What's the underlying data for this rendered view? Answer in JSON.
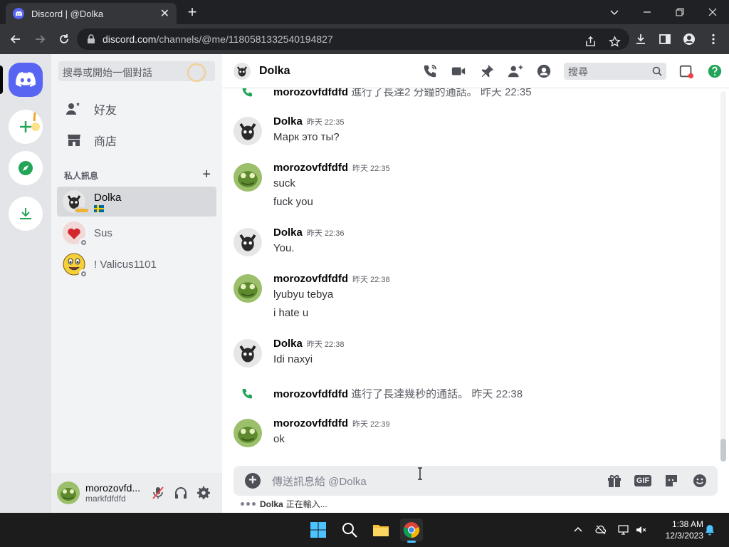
{
  "browser": {
    "tab_title": "Discord | @Dolka",
    "url_host": "discord.com",
    "url_path": "/channels/@me/1180581332540194827"
  },
  "sidebar": {
    "search_placeholder": "搜尋或開始一個對話",
    "friends_label": "好友",
    "shop_label": "商店",
    "dm_header": "私人訊息",
    "dms": [
      {
        "name": "Dolka",
        "selected": true
      },
      {
        "name": "Sus",
        "selected": false
      },
      {
        "name": "! Valicus1101",
        "selected": false
      }
    ]
  },
  "user_panel": {
    "display_name": "morozovfd...",
    "username": "markfdfdfd"
  },
  "chat": {
    "title": "Dolka",
    "search_placeholder": "搜尋",
    "composer_placeholder": "傳送訊息給 @Dolka",
    "gif_label": "GIF",
    "typing_user": "Dolka",
    "typing_text": "正在輸入...",
    "top_system": {
      "author": "morozovfdfdfd",
      "text": " 進行了長達2 分鐘的通話。",
      "time": "昨天 22:35"
    },
    "messages": [
      {
        "author": "Dolka",
        "time": "昨天 22:35",
        "lines": [
          "Марк это ты?"
        ]
      },
      {
        "author": "morozovfdfdfd",
        "time": "昨天 22:35",
        "lines": [
          "suck",
          "fuck you"
        ]
      },
      {
        "author": "Dolka",
        "time": "昨天 22:36",
        "lines": [
          "You."
        ]
      },
      {
        "author": "morozovfdfdfd",
        "time": "昨天 22:38",
        "lines": [
          "lyubyu tebya",
          "i hate u"
        ]
      },
      {
        "author": "Dolka",
        "time": "昨天 22:38",
        "lines": [
          "Idi naxyi"
        ]
      }
    ],
    "system_call": {
      "author": "morozovfdfdfd",
      "text": " 進行了長達幾秒的通話。",
      "time": "昨天 22:38"
    },
    "last_message": {
      "author": "morozovfdfdfd",
      "time": "昨天 22:39",
      "lines": [
        "ok"
      ]
    }
  },
  "taskbar": {
    "time": "1:38 AM",
    "date": "12/3/2023"
  },
  "colors": {
    "blurple": "#5865f2",
    "call_green": "#23a559",
    "help_green": "#23a559",
    "alert_red": "#f23f43"
  }
}
